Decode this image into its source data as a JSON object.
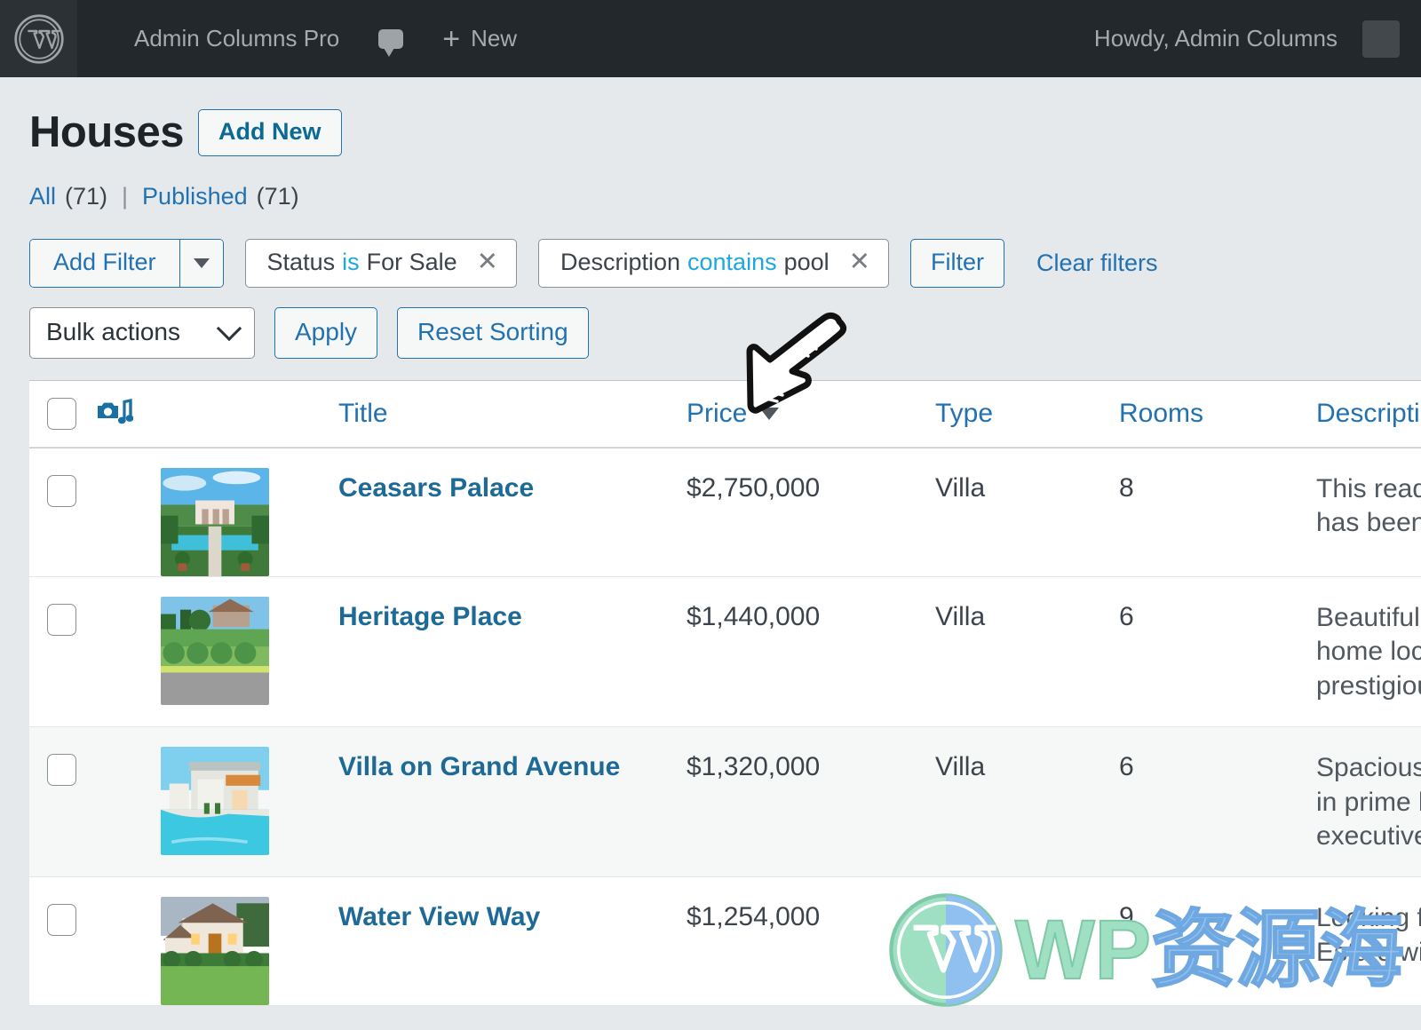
{
  "adminbar": {
    "logo_icon": "wordpress-logo-icon",
    "site_name": "Admin Columns Pro",
    "comments_icon": "comment-bubble-icon",
    "new_label": "New",
    "howdy": "Howdy,  Admin Columns",
    "avatar_icon": "avatar-placeholder"
  },
  "page": {
    "title": "Houses",
    "add_new_label": "Add New"
  },
  "views": {
    "all_label": "All",
    "all_count": "(71)",
    "separator": "|",
    "published_label": "Published",
    "published_count": "(71)"
  },
  "filters": {
    "add_filter_label": "Add Filter",
    "dropdown_caret_icon": "caret-down-icon",
    "chips": [
      {
        "field": "Status",
        "operator": "is",
        "value": "For Sale",
        "remove_icon": "close-icon"
      },
      {
        "field": "Description",
        "operator": "contains",
        "value": "pool",
        "remove_icon": "close-icon"
      }
    ],
    "filter_button_label": "Filter",
    "clear_filters_label": "Clear filters"
  },
  "bulk": {
    "select_value": "Bulk actions",
    "select_caret_icon": "chevron-down-icon",
    "apply_label": "Apply",
    "reset_sorting_label": "Reset Sorting"
  },
  "table": {
    "select_all_icon": "checkbox-unchecked",
    "media_column_icon": "media-gallery-icon",
    "columns": [
      {
        "key": "title",
        "label": "Title",
        "sorted": false
      },
      {
        "key": "price",
        "label": "Price",
        "sorted": true,
        "sort_icon": "sort-desc-caret"
      },
      {
        "key": "type",
        "label": "Type",
        "sorted": false
      },
      {
        "key": "rooms",
        "label": "Rooms",
        "sorted": false
      },
      {
        "key": "description",
        "label": "Description",
        "sorted": false
      }
    ],
    "rows": [
      {
        "checkbox_icon": "checkbox-unchecked",
        "thumb_alt": "villa-garden-thumbnail",
        "title": "Ceasars Palace",
        "price": "$2,750,000",
        "type": "Villa",
        "rooms": "8",
        "description_lines": [
          "This ready to",
          "has been fres"
        ]
      },
      {
        "checkbox_icon": "checkbox-unchecked",
        "thumb_alt": "hillside-house-thumbnail",
        "title": "Heritage Place",
        "price": "$1,440,000",
        "type": "Villa",
        "rooms": "6",
        "description_lines": [
          "Beautifully ap",
          "home located",
          "prestigious ga"
        ]
      },
      {
        "checkbox_icon": "checkbox-unchecked",
        "thumb_alt": "poolside-modern-villa-thumbnail",
        "title": "Villa on Grand Avenue",
        "price": "$1,320,000",
        "type": "Villa",
        "rooms": "6",
        "description_lines": [
          "Spacious and",
          "in prime locat",
          "executive styl"
        ]
      },
      {
        "checkbox_icon": "checkbox-unchecked",
        "thumb_alt": "suburban-estate-thumbnail",
        "title": "Water View Way",
        "price": "$1,254,000",
        "type": "Villa",
        "rooms": "9",
        "description_lines": [
          "Looking for a",
          "Estate with a"
        ]
      }
    ]
  },
  "annotation": {
    "arrow_icon": "hand-drawn-arrow-down-left"
  },
  "watermark": {
    "logo_icon": "wordpress-logo-watermark",
    "text_en": "WP",
    "text_cn": "资源海"
  },
  "colors": {
    "admin_bar": "#23282d",
    "page_bg": "#e5e9ec",
    "link": "#2271b1",
    "title_link": "#1d6a96",
    "operator": "#1ea8e0",
    "media_icon": "#1a6fa3",
    "watermark_green": "#9fe0c2",
    "watermark_blue": "#8fc0ef"
  }
}
